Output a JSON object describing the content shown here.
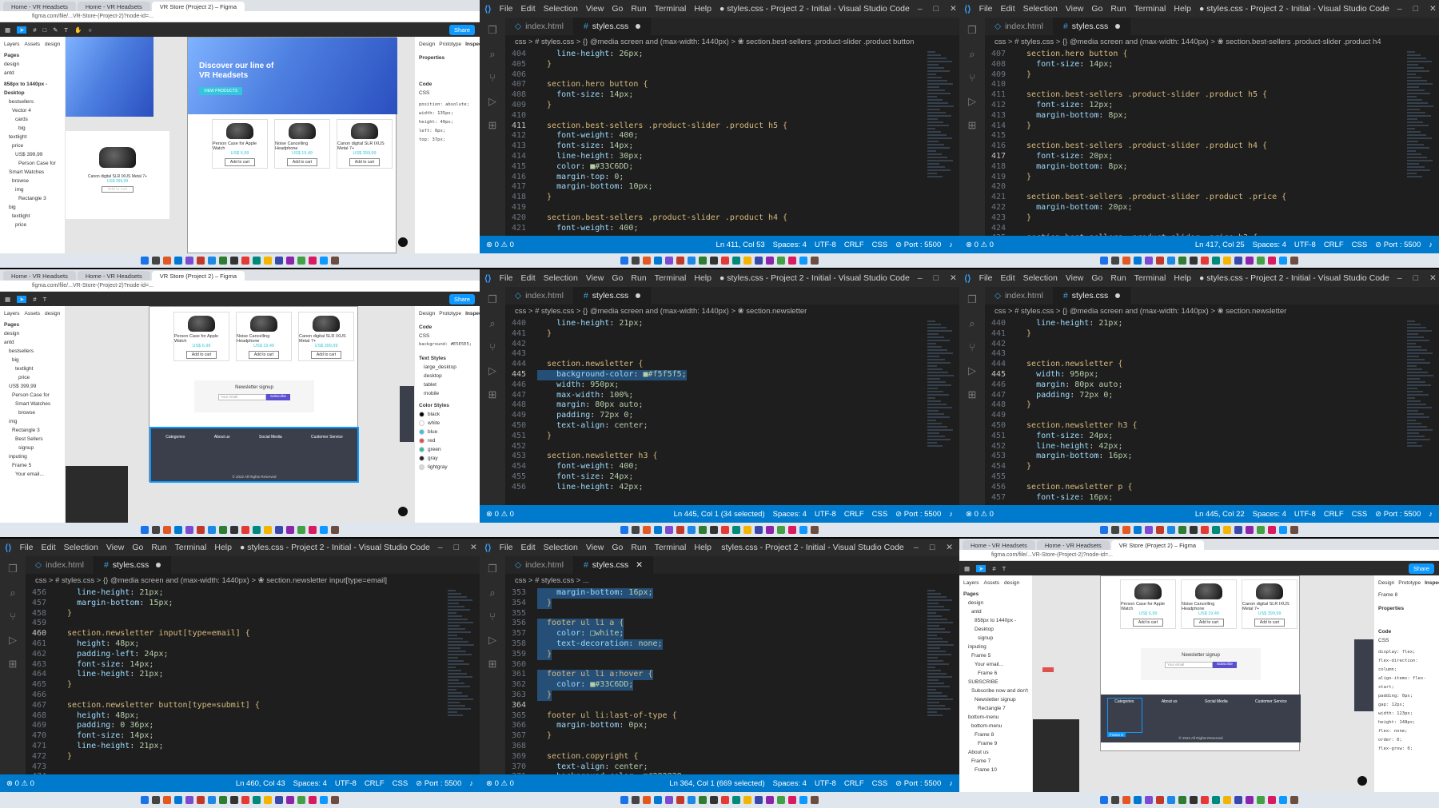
{
  "colors": {
    "accent": "#007acc",
    "teal": "#33C6DD",
    "footer_bg": "#282828",
    "newsletter_bg": "#f5f5f5",
    "figma_blue": "#0d99ff"
  },
  "vscode": {
    "menu": [
      "File",
      "Edit",
      "Selection",
      "View",
      "Go",
      "Run",
      "Terminal",
      "Help"
    ],
    "tab_html": "index.html",
    "tab_css": "styles.css",
    "window_title_modified": "● styles.css - Project 2 - Initial - Visual Studio Code",
    "window_title_saved": "styles.css - Project 2 - Initial - Visual Studio Code",
    "status_common": {
      "errors": "⊗ 0 ⚠ 0",
      "spaces": "Spaces: 4",
      "encoding": "UTF-8",
      "eol": "CRLF",
      "lang": "CSS",
      "port": "⊘ Port : 5500"
    },
    "panes": [
      {
        "breadcrumb": "css > # styles.css > {} @media screen and (max-width: 1440px) > ❀ section.best-sellers .product-slider .product button",
        "cursor": "Ln 411, Col 53",
        "lines": [
          {
            "n": "404",
            "t": "    line-height: 26px;"
          },
          {
            "n": "405",
            "t": "  }"
          },
          {
            "n": "406",
            "t": ""
          },
          {
            "n": "407",
            "t": "  section.hero button {"
          },
          {
            "n": "408",
            "t": "    font-size: 14px;"
          },
          {
            "n": "409",
            "t": "  }"
          },
          {
            "n": "410",
            "t": ""
          },
          {
            "n": "411",
            "t": "  section.best-sellers .product-slider .product h5 {",
            "cur": true
          },
          {
            "n": "412",
            "t": "    font-weight: 400;"
          },
          {
            "n": "413",
            "t": "    font-size: 14px;"
          },
          {
            "n": "414",
            "t": "    line-height: 30px;"
          },
          {
            "n": "415",
            "t": "    color: ■#33C6DD;"
          },
          {
            "n": "416",
            "t": "    margin-top: 0;"
          },
          {
            "n": "417",
            "t": "    margin-bottom: 10px;"
          },
          {
            "n": "418",
            "t": "  }"
          },
          {
            "n": "419",
            "t": ""
          },
          {
            "n": "420",
            "t": "  section.best-sellers .product-slider .product h4 {"
          },
          {
            "n": "421",
            "t": "    font-weight: 400;"
          }
        ]
      },
      {
        "breadcrumb": "css > # styles.css > {} @media screen and (max-width: 1440px) > ❀ section.best-sellers .product-slider .product h4",
        "cursor": "Ln 417, Col 25",
        "lines": [
          {
            "n": "407",
            "t": "  section.hero button {"
          },
          {
            "n": "408",
            "t": "    font-size: 14px;"
          },
          {
            "n": "409",
            "t": "  }"
          },
          {
            "n": "410",
            "t": ""
          },
          {
            "n": "411",
            "t": "  section.best-sellers .product-slider .product h5 {"
          },
          {
            "n": "412",
            "t": "    font-size: 12px;"
          },
          {
            "n": "413",
            "t": "    margin-bottom: 8px;"
          },
          {
            "n": "414",
            "t": "  }"
          },
          {
            "n": "415",
            "t": ""
          },
          {
            "n": "416",
            "t": "  section.best-sellers .product-slider .product h4 {"
          },
          {
            "n": "417",
            "t": "    font-size: 20px;",
            "cur": true
          },
          {
            "n": "418",
            "t": "    margin-bottom: 8px;"
          },
          {
            "n": "419",
            "t": "  }"
          },
          {
            "n": "420",
            "t": ""
          },
          {
            "n": "421",
            "t": "  section.best-sellers .product-slider .product .price {"
          },
          {
            "n": "422",
            "t": "    margin-bottom: 20px;"
          },
          {
            "n": "423",
            "t": "  }"
          },
          {
            "n": "424",
            "t": ""
          },
          {
            "n": "425",
            "t": "  section.best-sellers .product-slider .price h3 {"
          }
        ]
      },
      {
        "breadcrumb": "css > # styles.css > {} @media screen and (max-width: 1440px) > ❀ section.newsletter",
        "cursor": "Ln 445, Col 1 (34 selected)",
        "lines": [
          {
            "n": "440",
            "t": "    line-height: 21px;"
          },
          {
            "n": "441",
            "t": "  }"
          },
          {
            "n": "442",
            "t": ""
          },
          {
            "n": "443",
            "t": ""
          },
          {
            "n": "444",
            "t": "  section.newsletter {"
          },
          {
            "n": "445",
            "t": "    background-color: ■#f5f5f5;",
            "cur": true,
            "sel": true
          },
          {
            "n": "446",
            "t": "    width: 950px;"
          },
          {
            "n": "447",
            "t": "    max-width: 100%;"
          },
          {
            "n": "448",
            "t": "    margin: 80px auto;"
          },
          {
            "n": "449",
            "t": "    padding: 72px 0;"
          },
          {
            "n": "450",
            "t": "    text-align: center;"
          },
          {
            "n": "451",
            "t": "  }"
          },
          {
            "n": "452",
            "t": ""
          },
          {
            "n": "453",
            "t": "  section.newsletter h3 {"
          },
          {
            "n": "454",
            "t": "    font-weight: 400;"
          },
          {
            "n": "455",
            "t": "    font-size: 24px;"
          },
          {
            "n": "456",
            "t": "    line-height: 42px;"
          }
        ]
      },
      {
        "breadcrumb": "css > # styles.css > {} @media screen and (max-width: 1440px) > ❀ section.newsletter",
        "cursor": "Ln 445, Col 22",
        "lines": [
          {
            "n": "440",
            "t": "    line-height: 21px;"
          },
          {
            "n": "441",
            "t": "  }"
          },
          {
            "n": "442",
            "t": ""
          },
          {
            "n": "443",
            "t": ""
          },
          {
            "n": "444",
            "t": "  section.newsletter {"
          },
          {
            "n": "445",
            "t": "    width: 950px;",
            "cur": true
          },
          {
            "n": "446",
            "t": "    margin: 80px auto;"
          },
          {
            "n": "447",
            "t": "    padding: 72px 0;"
          },
          {
            "n": "448",
            "t": "  }"
          },
          {
            "n": "449",
            "t": ""
          },
          {
            "n": "450",
            "t": "  section.newsletter h3 {"
          },
          {
            "n": "451",
            "t": "    font-size: 24px;"
          },
          {
            "n": "452",
            "t": "    line-height: 42px;"
          },
          {
            "n": "453",
            "t": "    margin-bottom: 16px;"
          },
          {
            "n": "454",
            "t": "  }"
          },
          {
            "n": "455",
            "t": ""
          },
          {
            "n": "456",
            "t": "  section.newsletter p {"
          },
          {
            "n": "457",
            "t": "    font-size: 16px;"
          }
        ]
      },
      {
        "breadcrumb": "css > # styles.css > {} @media screen and (max-width: 1440px) > ❀ section.newsletter input[type=email]",
        "cursor": "Ln 460, Col 43",
        "lines": [
          {
            "n": "456",
            "t": "    line-height: 21px;"
          },
          {
            "n": "457",
            "t": "    margin-bottom: 15px;"
          },
          {
            "n": "458",
            "t": "  }"
          },
          {
            "n": "459",
            "t": ""
          },
          {
            "n": "460",
            "t": "  section.newsletter input[type=email] {",
            "cur": true
          },
          {
            "n": "461",
            "t": "    height: 48px;"
          },
          {
            "n": "462",
            "t": "    padding-left: 24px;"
          },
          {
            "n": "463",
            "t": "    font-size: 14px;"
          },
          {
            "n": "464",
            "t": "    line-height: 21px;"
          },
          {
            "n": "465",
            "t": "  }"
          },
          {
            "n": "466",
            "t": ""
          },
          {
            "n": "467",
            "t": "  section.newsletter button[type=submit] {"
          },
          {
            "n": "468",
            "t": "    height: 48px;"
          },
          {
            "n": "469",
            "t": "    padding: 0 36px;"
          },
          {
            "n": "470",
            "t": "    font-size: 14px;"
          },
          {
            "n": "471",
            "t": "    line-height: 21px;"
          },
          {
            "n": "472",
            "t": "  }"
          },
          {
            "n": "473",
            "t": ""
          },
          {
            "n": "474",
            "t": ""
          }
        ]
      },
      {
        "breadcrumb": "css > # styles.css > ...",
        "cursor": "Ln 364, Col 1 (669 selected)",
        "lines": [
          {
            "n": "353",
            "t": "    margin-bottom: 16px;",
            "sel": true
          },
          {
            "n": "354",
            "t": "  }",
            "sel": true
          },
          {
            "n": "355",
            "t": "",
            "sel": true
          },
          {
            "n": "356",
            "t": "  footer ul li a {",
            "sel": true
          },
          {
            "n": "357",
            "t": "    color: □white;",
            "sel": true
          },
          {
            "n": "358",
            "t": "    text-decoration: none;",
            "sel": true
          },
          {
            "n": "359",
            "t": "  }",
            "sel": true
          },
          {
            "n": "360",
            "t": "",
            "sel": true
          },
          {
            "n": "361",
            "t": "  footer ul li a:hover {",
            "sel": true
          },
          {
            "n": "362",
            "t": "    color: ■#33C6DD;",
            "sel": true
          },
          {
            "n": "363",
            "t": "  }",
            "sel": true
          },
          {
            "n": "364",
            "t": "",
            "cur": true
          },
          {
            "n": "365",
            "t": "  footer ul li:last-of-type {"
          },
          {
            "n": "366",
            "t": "    margin-bottom: 0px;"
          },
          {
            "n": "367",
            "t": "  }"
          },
          {
            "n": "368",
            "t": ""
          },
          {
            "n": "369",
            "t": "  section.copyright {"
          },
          {
            "n": "370",
            "t": "    text-align: center;"
          },
          {
            "n": "371",
            "t": "    background-color: ■#282828;"
          }
        ]
      }
    ]
  },
  "figma": {
    "browser_tabs": [
      "Home - VR Headsets",
      "Home - VR Headsets",
      "VR Store (Project 2) – Figma"
    ],
    "url": "figma.com/file/...VR-Store-(Project-2)?node-id=...",
    "share_label": "Share",
    "left_tabs": [
      "Layers",
      "Assets",
      "design"
    ],
    "pages_label": "Pages",
    "page_items": [
      "design",
      "antd"
    ],
    "frame_label": "858px to 1440px - Desktop",
    "layers_a": [
      "bestsellers",
      "Vector 4",
      "cards",
      "big",
      "textlight",
      "price",
      "US$ 399,99",
      "Person Case for",
      "Smart Watches",
      "browse",
      "img",
      "Rectangle 3",
      "big",
      "textlight",
      "price"
    ],
    "layers_b": [
      "bestsellers",
      "big",
      "textlight",
      "price",
      "US$ 399,99",
      "Person Case for",
      "Smart Watches",
      "browse",
      "img",
      "Rectangle 3",
      "Best Sellers",
      "signup",
      "inputing",
      "Frame 5",
      "Your email..."
    ],
    "layers_c": [
      "design",
      "antd",
      "858px to 1440px - Desktop",
      "signup",
      "inputing",
      "Frame 5",
      "Your email...",
      "Frame 6",
      "SUBSCRIBE",
      "Subscribe now and don't",
      "Newsletter signup",
      "Rectangle 7",
      "bottom-menu",
      "bottom-menu",
      "Frame 8",
      "Frame 9",
      "About us",
      "Frame 7",
      "Frame 10"
    ],
    "right_tabs": [
      "Design",
      "Prototype",
      "Inspect"
    ],
    "props_label": "Properties",
    "code_label": "Code",
    "css_label": "CSS",
    "hero_title": "Discover our line of VR Headsets",
    "hero_button": "VIEW PRODUCTS",
    "products": [
      {
        "name": "Person Case for Apple Watch",
        "price": "US$ 6,99",
        "btn": "Add to cart"
      },
      {
        "name": "Noise Cancelling Headphone",
        "price": "US$ 19,49",
        "btn": "Add to cart"
      },
      {
        "name": "Canon digital SLR IXUS Metal 7+",
        "price": "US$ 399,99",
        "btn": "Add to cart"
      }
    ],
    "side_product": {
      "name": "Canon digital SLR IXUS Metal 7+",
      "price": "US$ 399,99",
      "btn": "Add to cart"
    },
    "newsletter_title": "Newsletter signup",
    "newsletter_input": "Your email",
    "newsletter_btn": "Subscribe",
    "footer_cols": [
      "Categories",
      "About us",
      "Social Media",
      "Customer Service"
    ],
    "footer_copy": "© 2022 All Rights Reserved",
    "text_styles_label": "Text Styles",
    "text_styles": [
      "large_desktop",
      "desktop",
      "tablet",
      "mobile"
    ],
    "color_styles_label": "Color Styles",
    "color_styles": [
      {
        "name": "black",
        "hex": "#000000"
      },
      {
        "name": "white",
        "hex": "#ffffff"
      },
      {
        "name": "blue",
        "hex": "#33C6DD"
      },
      {
        "name": "red",
        "hex": "#e05050"
      },
      {
        "name": "green",
        "hex": "#2fbf9f"
      },
      {
        "name": "gray",
        "hex": "#282828"
      },
      {
        "name": "lightgray",
        "hex": "#d9d9d9"
      }
    ],
    "css_lines_a": [
      "position: absolute;",
      "width: 135px;",
      "height: 40px;",
      "left: 0px;",
      "top: 37px;"
    ],
    "css_lines_c": [
      "display: flex;",
      "flex-direction: column;",
      "align-items: flex-start;",
      "padding: 0px;",
      "gap: 12px;",
      "width: 123px;",
      "height: 148px;",
      "flex: none;",
      "order: 0;",
      "flex-grow: 0;"
    ],
    "bg_label": "background: #E5E5E5;",
    "frame8_label": "Frame 8"
  }
}
